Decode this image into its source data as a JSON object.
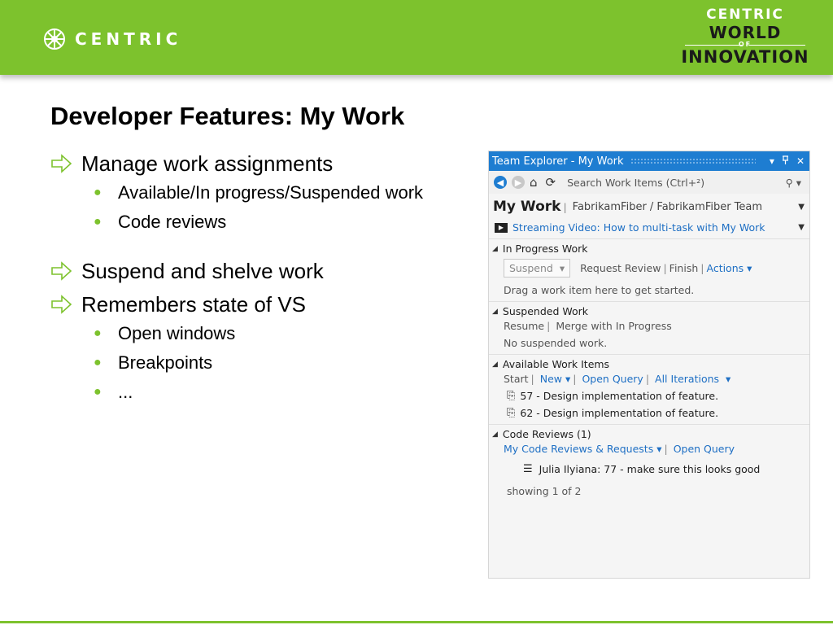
{
  "header": {
    "logo_text": "CENTRIC",
    "brand_line1": "CENTRIC",
    "brand_line2": "WORLD",
    "brand_line3": "OF",
    "brand_line4": "INNOVATION",
    "color": "#7dc22d"
  },
  "slide": {
    "title": "Developer Features: My Work",
    "bullets": [
      {
        "text": "Manage work assignments",
        "sub": [
          "Available/In progress/Suspended work",
          "Code reviews"
        ]
      },
      {
        "text": "Suspend and shelve work",
        "sub": []
      },
      {
        "text": "Remembers state of VS",
        "sub": [
          "Open windows",
          "Breakpoints",
          "..."
        ]
      }
    ]
  },
  "team_explorer": {
    "title": "Team Explorer - My Work",
    "title_controls": {
      "dropdown": "▾",
      "pin": "📌",
      "close": "✕"
    },
    "search_placeholder": "Search Work Items (Ctrl+²)",
    "page_name": "My Work",
    "page_context": "FabrikamFiber / FabrikamFiber Team",
    "streaming_video": "Streaming Video: How to multi-task with My Work",
    "in_progress": {
      "title": "In Progress Work",
      "suspend_label": "Suspend",
      "request_review": "Request Review",
      "finish": "Finish",
      "actions": "Actions",
      "hint": "Drag a work item here to get started."
    },
    "suspended": {
      "title": "Suspended Work",
      "resume": "Resume",
      "merge": "Merge with In Progress",
      "empty": "No suspended work."
    },
    "available": {
      "title": "Available Work Items",
      "start": "Start",
      "new": "New",
      "open_query": "Open Query",
      "all_iterations": "All Iterations",
      "items": [
        "57 - Design implementation of feature.",
        "62 - Design implementation of feature."
      ]
    },
    "code_reviews": {
      "title": "Code Reviews (1)",
      "my_reviews": "My Code Reviews & Requests",
      "open_query": "Open Query",
      "item": "Julia Ilyiana: 77 - make sure this looks good",
      "showing": "showing 1 of 2"
    },
    "accent_color": "#1e7dd1"
  }
}
